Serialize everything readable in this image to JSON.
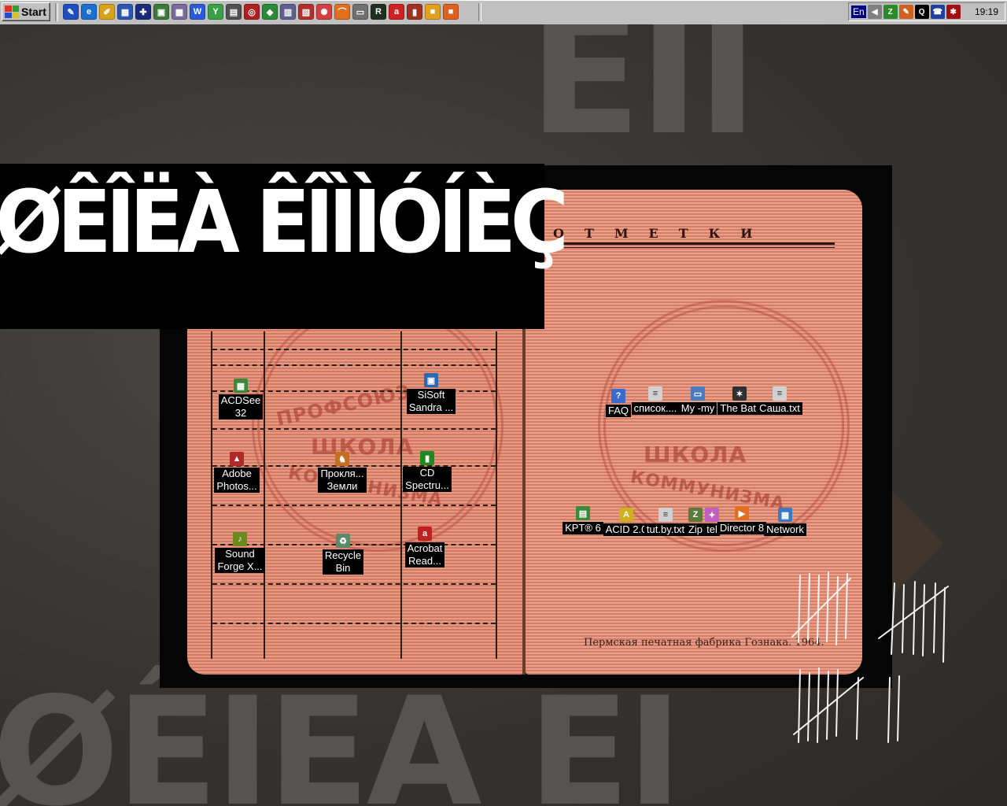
{
  "taskbar": {
    "start_label": "Start",
    "quick_launch": [
      {
        "icon": "notepad-edit-icon",
        "color": "#1f4fbf",
        "glyph": "✎"
      },
      {
        "icon": "internet-explorer-icon",
        "color": "#1c6fd1",
        "glyph": "e"
      },
      {
        "icon": "pencil-tool-icon",
        "color": "#d8a21c",
        "glyph": "✐"
      },
      {
        "icon": "window-grid-icon",
        "color": "#2a55b0",
        "glyph": "▦"
      },
      {
        "icon": "uk-flag-icon",
        "color": "#1a2a7a",
        "glyph": "✚"
      },
      {
        "icon": "image-viewer-icon",
        "color": "#3a7a3a",
        "glyph": "▣"
      },
      {
        "icon": "pattern-icon",
        "color": "#7a6a9a",
        "glyph": "▩"
      },
      {
        "icon": "word-icon",
        "color": "#2a5bd6",
        "glyph": "W"
      },
      {
        "icon": "vector-tool-icon",
        "color": "#3aa048",
        "glyph": "Y"
      },
      {
        "icon": "chart-window-icon",
        "color": "#505050",
        "glyph": "▤"
      },
      {
        "icon": "target-icon",
        "color": "#b02020",
        "glyph": "◎"
      },
      {
        "icon": "diamond-icon",
        "color": "#2a8a3a",
        "glyph": "◆"
      },
      {
        "icon": "cabinet-icon",
        "color": "#606090",
        "glyph": "▥"
      },
      {
        "icon": "photo-editor-icon",
        "color": "#b03030",
        "glyph": "▧"
      },
      {
        "icon": "color-wheel-icon",
        "color": "#d04040",
        "glyph": "✺"
      },
      {
        "icon": "arch-icon",
        "color": "#e07020",
        "glyph": "⌒"
      },
      {
        "icon": "film-icon",
        "color": "#707070",
        "glyph": "▭"
      },
      {
        "icon": "r-app-icon",
        "color": "#203020",
        "glyph": "R"
      },
      {
        "icon": "acrobat-icon",
        "color": "#d02020",
        "glyph": "a"
      },
      {
        "icon": "books-icon",
        "color": "#a03020",
        "glyph": "▮"
      },
      {
        "icon": "box-icon",
        "color": "#e0a020",
        "glyph": "■"
      },
      {
        "icon": "package-icon",
        "color": "#e06020",
        "glyph": "■"
      }
    ],
    "tray": {
      "language": "En",
      "icons": [
        {
          "icon": "speaker-icon",
          "color": "#808080",
          "glyph": "◀"
        },
        {
          "icon": "zip-tray-icon",
          "color": "#2a8a2a",
          "glyph": "Z"
        },
        {
          "icon": "paint-tray-icon",
          "color": "#d06020",
          "glyph": "✎"
        },
        {
          "icon": "quicktime-icon",
          "color": "#000000",
          "glyph": "Q"
        },
        {
          "icon": "phone-icon",
          "color": "#2040a0",
          "glyph": "☎"
        },
        {
          "icon": "bug-icon",
          "color": "#a01010",
          "glyph": "✱"
        }
      ],
      "time": "19:19"
    }
  },
  "wallpaper": {
    "banner_text": "ØÊÎËÀ ÊÎÌÌÓÍÈÇ",
    "background_text_top": "ÊÎÌ",
    "background_text_bottom": "ØÊÎËÀ ÊÎ",
    "stamp_lines": [
      "ПРОФСОЮЗ",
      "ШКОЛА",
      "КОММУНИЗМА"
    ],
    "page_header": "ОТМЕТКИ",
    "page_footer": "Пермская печатная фабрика Гознака. 1964."
  },
  "desktop_icons": [
    {
      "name": "acdsee-icon",
      "label": "ACDSee\n32",
      "color": "#3b8a3b",
      "glyph": "▦"
    },
    {
      "name": "sisoft-sandra-icon",
      "label": "SiSoft\nSandra ...",
      "color": "#2a6ab0",
      "glyph": "▣"
    },
    {
      "name": "adobe-photoshop-icon",
      "label": "Adobe\nPhotos...",
      "color": "#b02a2a",
      "glyph": "▲"
    },
    {
      "name": "proklyatye-zemli-icon",
      "label": "Прокля...\nЗемли",
      "color": "#c07020",
      "glyph": "♞"
    },
    {
      "name": "cd-spectrum-icon",
      "label": "CD\nSpectru...",
      "color": "#208a20",
      "glyph": "▮"
    },
    {
      "name": "sound-forge-icon",
      "label": "Sound\nForge X...",
      "color": "#6a8a20",
      "glyph": "♪"
    },
    {
      "name": "recycle-bin-icon",
      "label": "Recycle\nBin",
      "color": "#5a8a6a",
      "glyph": "♻"
    },
    {
      "name": "acrobat-reader-icon",
      "label": "Acrobat\nRead...",
      "color": "#c02020",
      "glyph": "a"
    },
    {
      "name": "faq-icon",
      "label": "FAQ",
      "color": "#3a6ad0",
      "glyph": "?"
    },
    {
      "name": "spisok-file-icon",
      "label": "список....",
      "color": "#d0d0d0",
      "glyph": "≡"
    },
    {
      "name": "my-my-icon",
      "label": "My -my",
      "color": "#4a7ac0",
      "glyph": "▭"
    },
    {
      "name": "the-bat-icon",
      "label": "The Bat!",
      "color": "#303030",
      "glyph": "✶"
    },
    {
      "name": "sasha-txt-icon",
      "label": "Саша.txt",
      "color": "#d0d0d0",
      "glyph": "≡"
    },
    {
      "name": "kpt6-icon",
      "label": "KPT® 6",
      "color": "#3a8a3a",
      "glyph": "▤"
    },
    {
      "name": "acid-icon",
      "label": "ACID 2.0",
      "color": "#d0b020",
      "glyph": "A"
    },
    {
      "name": "tut-by-txt-icon",
      "label": "tut.by.txt",
      "color": "#d0d0d0",
      "glyph": "≡"
    },
    {
      "name": "zip-icon",
      "label": "Zip",
      "color": "#5a7a3a",
      "glyph": "Z"
    },
    {
      "name": "tel-icon",
      "label": "tel",
      "color": "#c060c0",
      "glyph": "✦"
    },
    {
      "name": "director-8-icon",
      "label": "Director 8",
      "color": "#e07020",
      "glyph": "▶"
    },
    {
      "name": "network-icon",
      "label": "Network",
      "color": "#3a7ac0",
      "glyph": "▦"
    }
  ]
}
